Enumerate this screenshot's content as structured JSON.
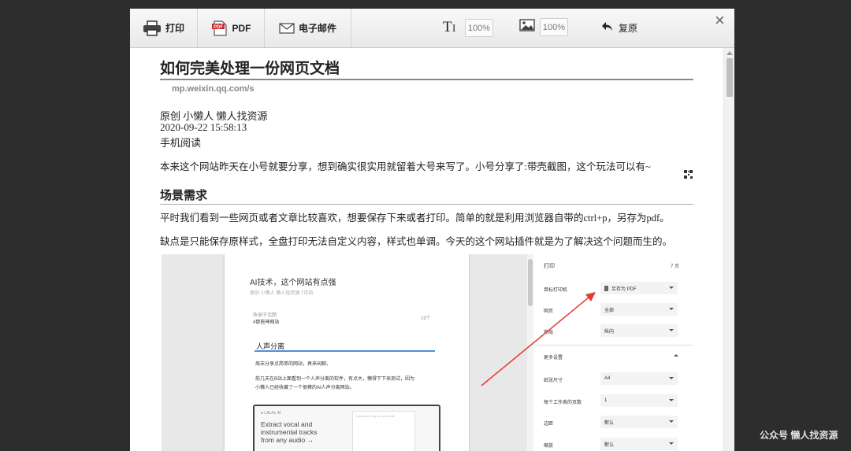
{
  "toolbar": {
    "print_label": "打印",
    "pdf_label": "PDF",
    "pdf_icon_text": "PDF",
    "email_label": "电子邮件",
    "text_zoom": "100%",
    "image_zoom": "100%",
    "restore_label": "复原",
    "close_label": "×"
  },
  "article": {
    "title": "如何完美处理一份网页文档",
    "source": "mp.weixin.qq.com/s",
    "meta_line": "原创 小懒人 懒人找资源",
    "datetime": "2020-09-22 15:58:13",
    "read_on_phone": "手机阅读",
    "intro": "本来这个网站昨天在小号就要分享，想到确实很实用就留着大号来写了。小号分享了:带壳截图，这个玩法可以有~",
    "section_heading": "场景需求",
    "para1": "平时我们看到一些网页或者文章比较喜欢，想要保存下来或者打印。简单的就是利用浏览器自带的ctrl+p，另存为pdf。",
    "para2": "缺点是只能保存原样式，全盘打印无法自定义内容，样式也单调。今天的这个网站插件就是为了解决这个问题而生的。"
  },
  "screenshot": {
    "page": {
      "title": "AI技术，这个网站有点强",
      "author_line": "原创  小懒人  懒人找资源  7月前",
      "tag1": "收录于话题",
      "tag2": "#那些神网站",
      "count": "19个",
      "section": "人声分离",
      "p1": "周末分享点简单的网站，再来闲聊。",
      "p2": "前几天在B站上面看到一个人声分离的软件，有点大，懒得下下来测试，因为",
      "p3": "小懒人已经收藏了一个很棒的AI人声分离网站。",
      "card_logo": "● LALAL.AI",
      "card_text": "Extract vocal and\ninstrumental tracks\nfrom any audio →",
      "card_box_text": "Upload or drop\nan audio file"
    },
    "print_panel": {
      "title": "打印",
      "pages_count": "7 页",
      "rows": [
        {
          "label": "目标打印机",
          "value": "另存为 PDF"
        },
        {
          "label": "网页",
          "value": "全部"
        },
        {
          "label": "布局",
          "value": "纵向"
        }
      ],
      "more_settings": "更多设置",
      "rows2": [
        {
          "label": "纸张尺寸",
          "value": "A4"
        },
        {
          "label": "每个工作表的页数",
          "value": "1"
        },
        {
          "label": "边距",
          "value": "默认"
        },
        {
          "label": "缩放",
          "value": "默认"
        }
      ]
    },
    "annotation_arrow_color": "#e53935"
  },
  "watermark": "公众号 懒人找资源",
  "icons": [
    "printer-icon",
    "pdf-icon",
    "envelope-icon",
    "text-size-icon",
    "image-icon",
    "undo-icon",
    "close-icon",
    "qr-code-icon",
    "file-icon"
  ]
}
